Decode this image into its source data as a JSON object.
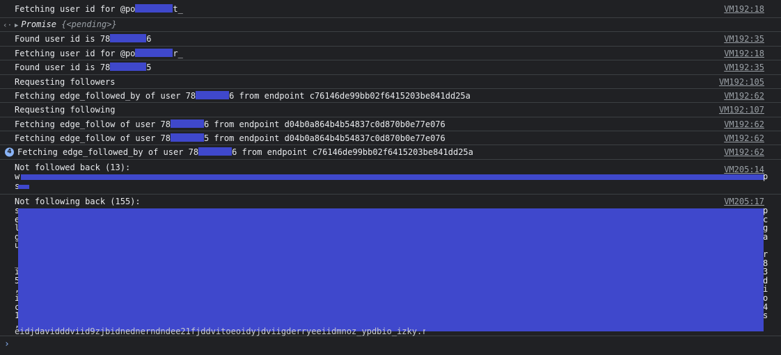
{
  "rows": [
    {
      "pre": "Fetching user id for @po",
      "post": "t_",
      "src": "VM192:18"
    },
    {
      "src": ""
    },
    {
      "pre": "Found user id is 78",
      "post": "6",
      "src": "VM192:35"
    },
    {
      "pre": "Fetching user id for @po",
      "post": "r_",
      "src": "VM192:18"
    },
    {
      "pre": "Found user id is 78",
      "post": "5",
      "src": "VM192:35"
    },
    {
      "text": "Requesting followers",
      "src": "VM192:105"
    },
    {
      "pre": "Fetching edge_followed_by of user 78",
      "post": "6 from endpoint c76146de99bb02f6415203be841dd25a",
      "src": "VM192:62"
    },
    {
      "text": "Requesting following",
      "src": "VM192:107"
    },
    {
      "pre": "Fetching edge_follow of user 78",
      "post": "6 from endpoint d04b0a864b4b54837c0d870b0e77e076",
      "src": "VM192:62"
    },
    {
      "pre": "Fetching edge_follow of user 78",
      "post": "5 from endpoint d04b0a864b4b54837c0d870b0e77e076",
      "src": "VM192:62"
    },
    {
      "pre": "Fetching edge_followed_by of user 78",
      "post": "6 from endpoint c76146de99bb02f6415203be841dd25a",
      "src": "VM192:62",
      "count": "4"
    }
  ],
  "promise": {
    "name": "Promise",
    "state": "{<pending>}"
  },
  "not_followed_back": {
    "label": "Not followed back (13):",
    "src": "VM205:14",
    "line2_end": "p",
    "line3_start": "s"
  },
  "not_following_back": {
    "label": "Not following back (155):",
    "src": "VM205:17",
    "left_chars": [
      "s",
      "e",
      "l",
      "g",
      "u",
      "",
      "_",
      "i",
      "5",
      ",",
      "i",
      "c",
      "1",
      ",",
      ""
    ],
    "right_chars": [
      "p",
      "c",
      "g",
      "a",
      "",
      "r",
      "8",
      "3",
      "d",
      "i",
      "o",
      "4",
      "s",
      "",
      ""
    ],
    "tail": "eidjdavidddviid9zjbidnednerndndee21fjddvitoeoidyjdviigderryeeiidmnoz_ypdbio_izky.rnendres."
  },
  "icons": {
    "collapse": "arrow-back-icon",
    "prompt": "chevron-right-icon"
  }
}
